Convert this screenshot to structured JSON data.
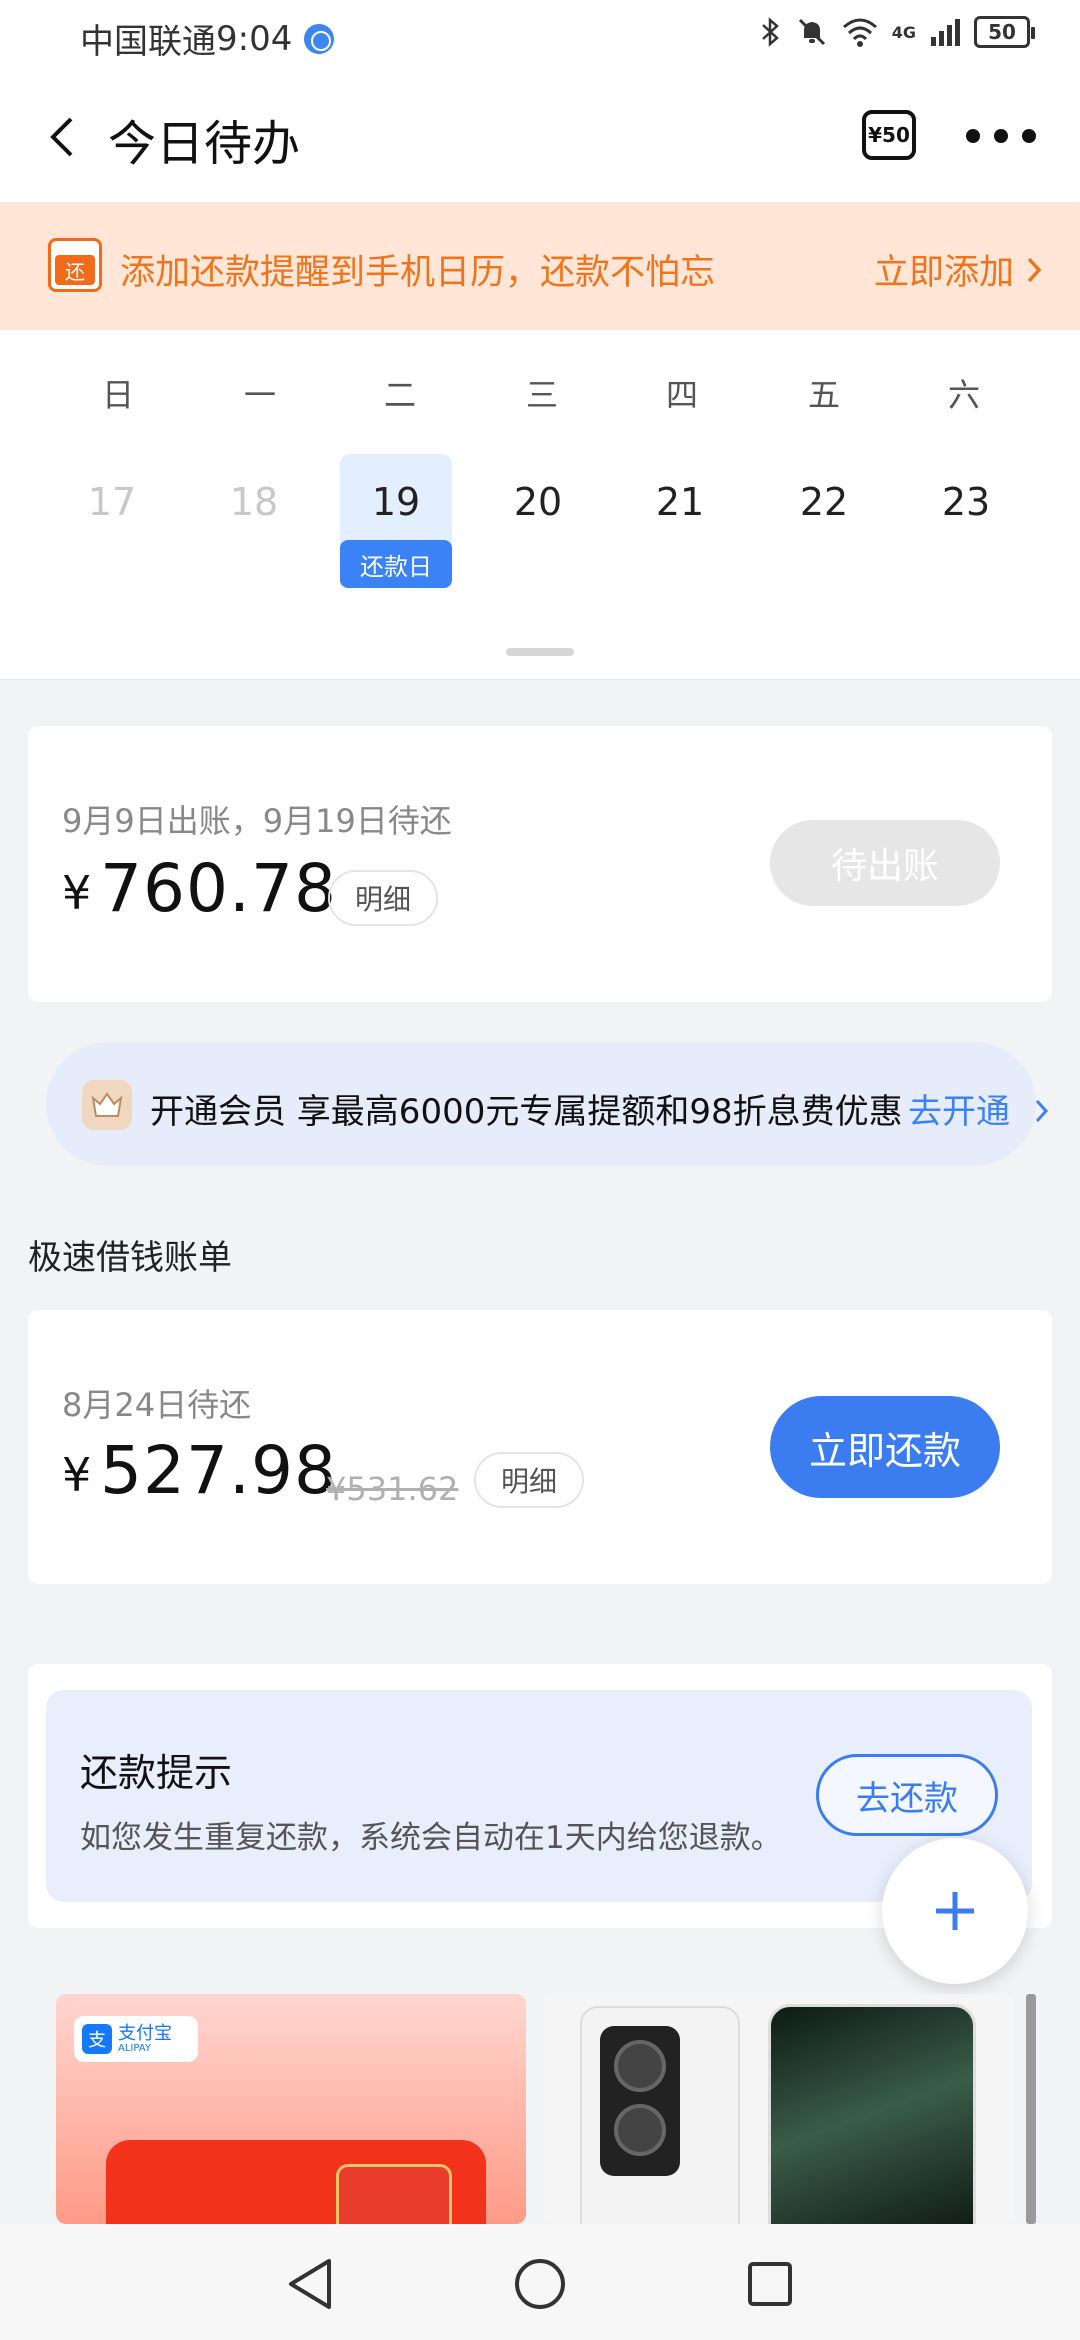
{
  "status_bar": {
    "carrier": "中国联通",
    "time": "9:04",
    "network": "4G",
    "battery": "50"
  },
  "header": {
    "title": "今日待办",
    "coupon_label": "¥50"
  },
  "banner": {
    "icon_label": "还",
    "text": "添加还款提醒到手机日历，还款不怕忘",
    "action": "立即添加"
  },
  "calendar": {
    "weekdays": [
      "日",
      "一",
      "二",
      "三",
      "四",
      "五",
      "六"
    ],
    "dates": [
      "17",
      "18",
      "19",
      "20",
      "21",
      "22",
      "23"
    ],
    "today_tag": "还款日"
  },
  "bill": {
    "subtitle": "9月9日出账，9月19日待还",
    "currency": "¥",
    "amount": "760.78",
    "detail_label": "明细",
    "status_button": "待出账"
  },
  "promo": {
    "text": "开通会员 享最高6000元专属提额和98折息费优惠",
    "link": "去开通"
  },
  "loan_section": {
    "title": "极速借钱账单",
    "subtitle": "8月24日待还",
    "currency": "¥",
    "amount": "527.98",
    "original_amount": "¥531.62",
    "detail_label": "明细",
    "repay_button": "立即还款"
  },
  "tip": {
    "title": "还款提示",
    "description": "如您发生重复还款，系统会自动在1天内给您退款。",
    "button": "去还款"
  },
  "ads": {
    "alipay_name": "支付宝",
    "alipay_en": "ALIPAY",
    "alipay_glyph": "支"
  },
  "colors": {
    "accent_blue": "#3b7cf0",
    "banner_orange": "#f0741e",
    "banner_bg": "#ffe6d6"
  }
}
